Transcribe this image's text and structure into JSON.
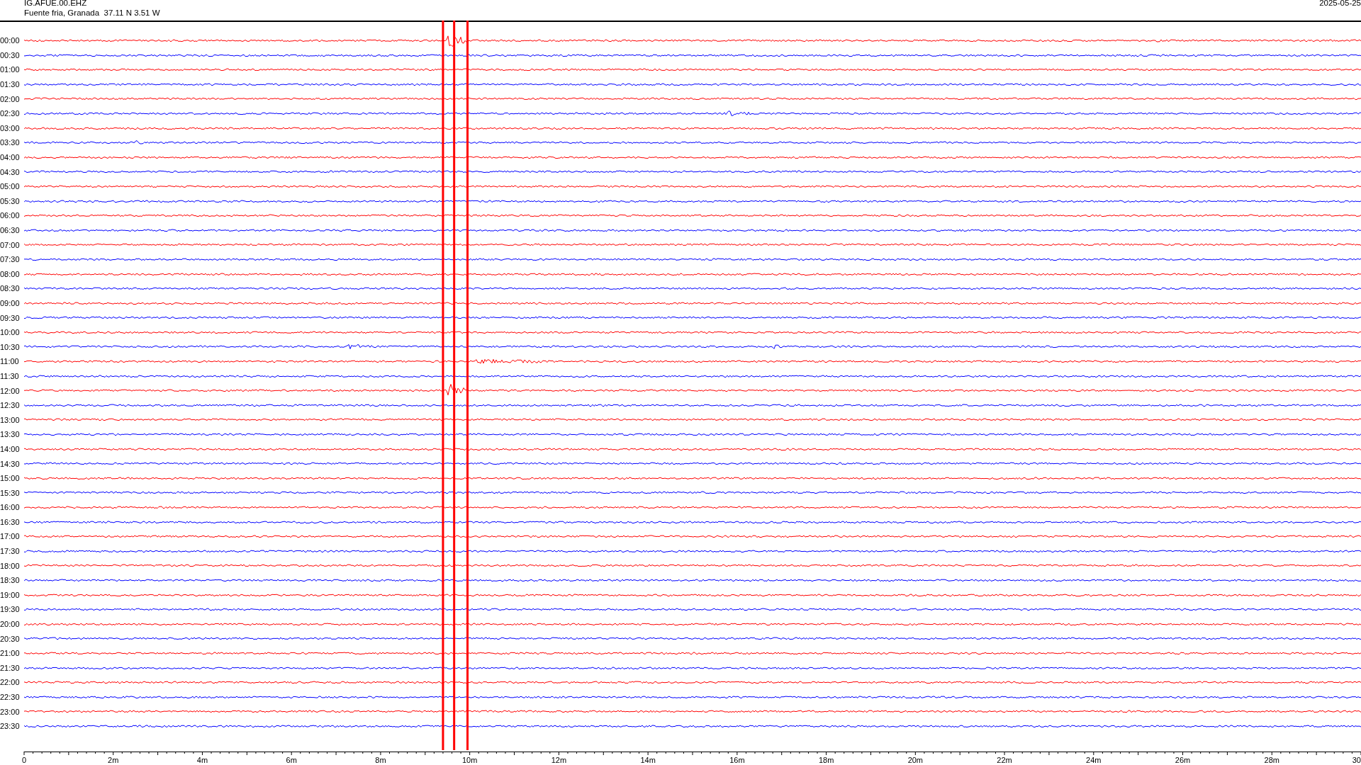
{
  "header": {
    "station": "IG.AFUE.00.EHZ",
    "location": "Fuente fria, Granada  37.11 N 3.51 W",
    "date": "2025-05-25"
  },
  "traces": [
    {
      "time": "00:00",
      "color": "#ff0000"
    },
    {
      "time": "00:30",
      "color": "#0000ff"
    },
    {
      "time": "01:00",
      "color": "#ff0000"
    },
    {
      "time": "01:30",
      "color": "#0000ff"
    },
    {
      "time": "02:00",
      "color": "#ff0000"
    },
    {
      "time": "02:30",
      "color": "#0000ff"
    },
    {
      "time": "03:00",
      "color": "#ff0000"
    },
    {
      "time": "03:30",
      "color": "#0000ff"
    },
    {
      "time": "04:00",
      "color": "#ff0000"
    },
    {
      "time": "04:30",
      "color": "#0000ff"
    },
    {
      "time": "05:00",
      "color": "#ff0000"
    },
    {
      "time": "05:30",
      "color": "#0000ff"
    },
    {
      "time": "06:00",
      "color": "#ff0000"
    },
    {
      "time": "06:30",
      "color": "#0000ff"
    },
    {
      "time": "07:00",
      "color": "#ff0000"
    },
    {
      "time": "07:30",
      "color": "#0000ff"
    },
    {
      "time": "08:00",
      "color": "#ff0000"
    },
    {
      "time": "08:30",
      "color": "#0000ff"
    },
    {
      "time": "09:00",
      "color": "#ff0000"
    },
    {
      "time": "09:30",
      "color": "#0000ff"
    },
    {
      "time": "10:00",
      "color": "#ff0000"
    },
    {
      "time": "10:30",
      "color": "#0000ff"
    },
    {
      "time": "11:00",
      "color": "#ff0000"
    },
    {
      "time": "11:30",
      "color": "#0000ff"
    },
    {
      "time": "12:00",
      "color": "#ff0000"
    },
    {
      "time": "12:30",
      "color": "#0000ff"
    },
    {
      "time": "13:00",
      "color": "#ff0000"
    },
    {
      "time": "13:30",
      "color": "#0000ff"
    },
    {
      "time": "14:00",
      "color": "#ff0000"
    },
    {
      "time": "14:30",
      "color": "#0000ff"
    },
    {
      "time": "15:00",
      "color": "#ff0000"
    },
    {
      "time": "15:30",
      "color": "#0000ff"
    },
    {
      "time": "16:00",
      "color": "#ff0000"
    },
    {
      "time": "16:30",
      "color": "#0000ff"
    },
    {
      "time": "17:00",
      "color": "#ff0000"
    },
    {
      "time": "17:30",
      "color": "#0000ff"
    },
    {
      "time": "18:00",
      "color": "#ff0000"
    },
    {
      "time": "18:30",
      "color": "#0000ff"
    },
    {
      "time": "19:00",
      "color": "#ff0000"
    },
    {
      "time": "19:30",
      "color": "#0000ff"
    },
    {
      "time": "20:00",
      "color": "#ff0000"
    },
    {
      "time": "20:30",
      "color": "#0000ff"
    },
    {
      "time": "21:00",
      "color": "#ff0000"
    },
    {
      "time": "21:30",
      "color": "#0000ff"
    },
    {
      "time": "22:00",
      "color": "#ff0000"
    },
    {
      "time": "22:30",
      "color": "#0000ff"
    },
    {
      "time": "23:00",
      "color": "#ff0000"
    },
    {
      "time": "23:30",
      "color": "#0000ff"
    }
  ],
  "time_axis": {
    "ticks": [
      "0",
      "2m",
      "4m",
      "6m",
      "8m",
      "10m",
      "12m",
      "14m",
      "16m",
      "18m",
      "20m",
      "22m",
      "24m",
      "26m",
      "28m",
      "30"
    ]
  }
}
